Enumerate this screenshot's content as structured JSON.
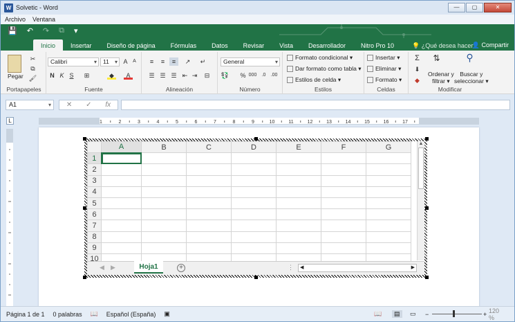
{
  "window": {
    "title": "Solvetic - Word",
    "icon": "W",
    "buttons": [
      "—",
      "▢",
      "✕"
    ]
  },
  "menu": [
    "Archivo",
    "Ventana"
  ],
  "qat": [
    "💾",
    "↶",
    "↷",
    "⧉",
    "▾"
  ],
  "tabs": [
    "Inicio",
    "Insertar",
    "Diseño de página",
    "Fórmulas",
    "Datos",
    "Revisar",
    "Vista",
    "Desarrollador",
    "Nitro Pro 10"
  ],
  "tellme": "¿Qué desea hacer?",
  "share": "Compartir",
  "ribbon": {
    "portapapeles": {
      "label": "Portapapeles",
      "paste": "Pegar"
    },
    "fuente": {
      "label": "Fuente",
      "font": "Calibri",
      "size": "11",
      "bold": "N",
      "italic": "K",
      "underline": "S"
    },
    "alineacion": {
      "label": "Alineación"
    },
    "numero": {
      "label": "Número",
      "format": "General"
    },
    "estilos": {
      "label": "Estilos",
      "cond": "Formato condicional",
      "table": "Dar formato como tabla",
      "cell": "Estilos de celda"
    },
    "celdas": {
      "label": "Celdas",
      "insert": "Insertar",
      "delete": "Eliminar",
      "format": "Formato"
    },
    "modificar": {
      "label": "Modificar",
      "sort": "Ordenar y",
      "sort2": "filtrar",
      "find": "Buscar y",
      "find2": "seleccionar"
    }
  },
  "formula": {
    "namebox": "A1",
    "cancel": "✕",
    "enter": "✓",
    "fx": "fx",
    "value": ""
  },
  "ruler": {
    "marks": [
      "1",
      "2",
      "3",
      "4",
      "5",
      "6",
      "7",
      "8",
      "9",
      "10",
      "11",
      "12",
      "13",
      "14",
      "15",
      "16",
      "17"
    ]
  },
  "sheet": {
    "columns": [
      "A",
      "B",
      "C",
      "D",
      "E",
      "F",
      "G"
    ],
    "rows": [
      "1",
      "2",
      "3",
      "4",
      "5",
      "6",
      "7",
      "8",
      "9",
      "10"
    ],
    "active_cell": "A1",
    "tab": "Hoja1"
  },
  "status": {
    "page": "Página 1 de 1",
    "words": "0 palabras",
    "lang": "Español (España)",
    "zoom": "120 %"
  }
}
